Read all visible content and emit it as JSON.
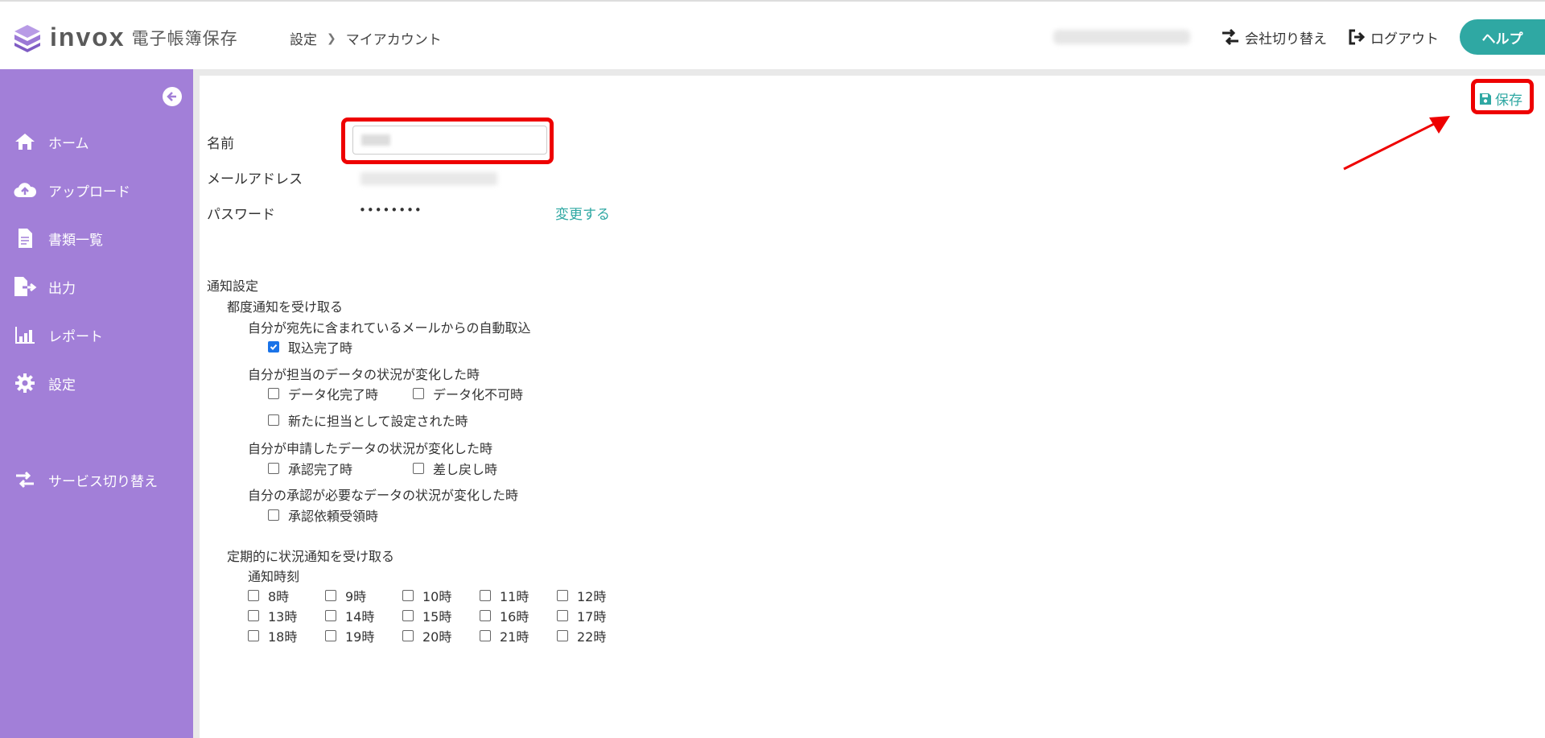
{
  "header": {
    "logo_text": "invox",
    "logo_sub": "電子帳簿保存",
    "breadcrumb": [
      "設定",
      "マイアカウント"
    ],
    "company_switch": "会社切り替え",
    "logout": "ログアウト",
    "help": "ヘルプ"
  },
  "sidebar": {
    "items": [
      {
        "label": "ホーム",
        "icon": "home-icon"
      },
      {
        "label": "アップロード",
        "icon": "cloud-upload-icon"
      },
      {
        "label": "書類一覧",
        "icon": "document-icon"
      },
      {
        "label": "出力",
        "icon": "export-icon"
      },
      {
        "label": "レポート",
        "icon": "report-chart-icon"
      },
      {
        "label": "設定",
        "icon": "gear-icon"
      },
      {
        "label": "サービス切り替え",
        "icon": "switch-icon"
      }
    ]
  },
  "main": {
    "save_label": "保存",
    "name_label": "名前",
    "email_label": "メールアドレス",
    "password_label": "パスワード",
    "password_value": "••••••••",
    "change_link": "変更する",
    "notification": {
      "title": "通知設定",
      "each_title": "都度通知を受け取る",
      "group1_title": "自分が宛先に含まれているメールからの自動取込",
      "g1_opt1": "取込完了時",
      "group2_title": "自分が担当のデータの状況が変化した時",
      "g2_opt1": "データ化完了時",
      "g2_opt2": "データ化不可時",
      "g2_opt3": "新たに担当として設定された時",
      "group3_title": "自分が申請したデータの状況が変化した時",
      "g3_opt1": "承認完了時",
      "g3_opt2": "差し戻し時",
      "group4_title": "自分の承認が必要なデータの状況が変化した時",
      "g4_opt1": "承認依頼受領時",
      "periodic_title": "定期的に状況通知を受け取る",
      "time_title": "通知時刻",
      "hours": [
        "8時",
        "9時",
        "10時",
        "11時",
        "12時",
        "13時",
        "14時",
        "15時",
        "16時",
        "17時",
        "18時",
        "19時",
        "20時",
        "21時",
        "22時"
      ]
    }
  },
  "colors": {
    "sidebar": "#a27fd8",
    "accent": "#2fa8a3",
    "highlight": "#e00000"
  }
}
